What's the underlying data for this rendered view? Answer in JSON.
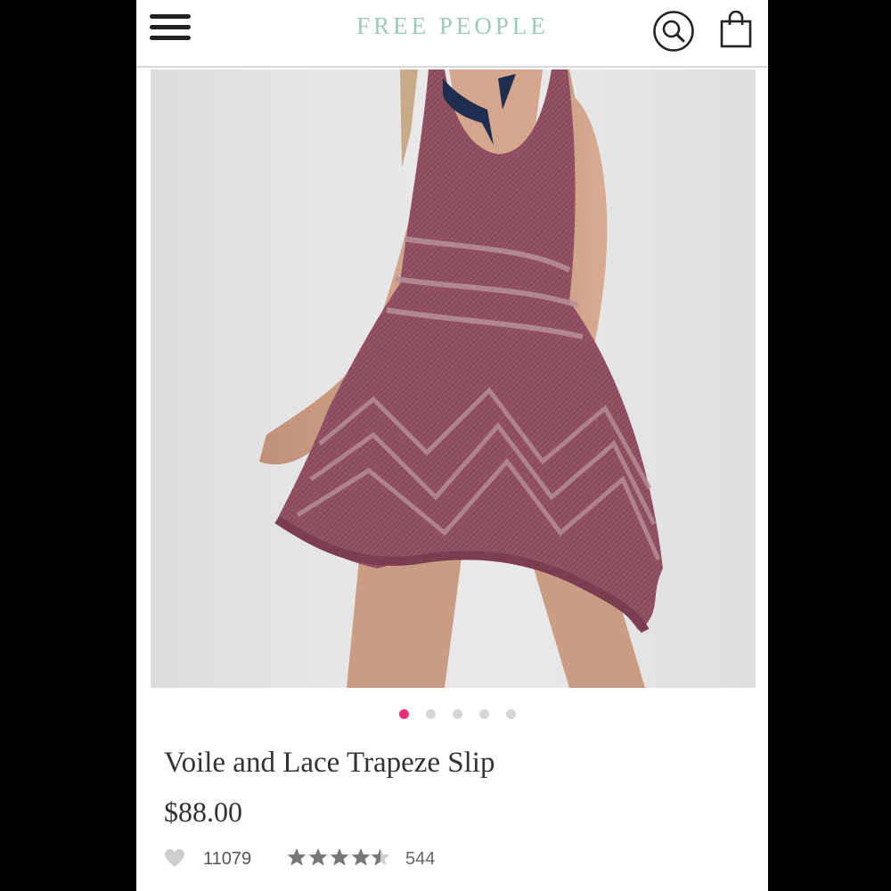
{
  "header": {
    "brand": "FREE PEOPLE",
    "menu_icon": "hamburger-menu-icon",
    "search_icon": "search-icon",
    "bag_icon": "shopping-bag-icon"
  },
  "product": {
    "title": "Voile and Lace Trapeze Slip",
    "price": "$88.00",
    "favorites_count": "11079",
    "rating": 4.5,
    "rating_max": 5,
    "review_count": "544",
    "image_count": 5,
    "active_image_index": 0
  },
  "colors": {
    "brand": "#9cc9ba",
    "active_dot": "#ee2c7c",
    "inactive_dot": "#d6d6d6",
    "dress": "#8a4a5c"
  }
}
